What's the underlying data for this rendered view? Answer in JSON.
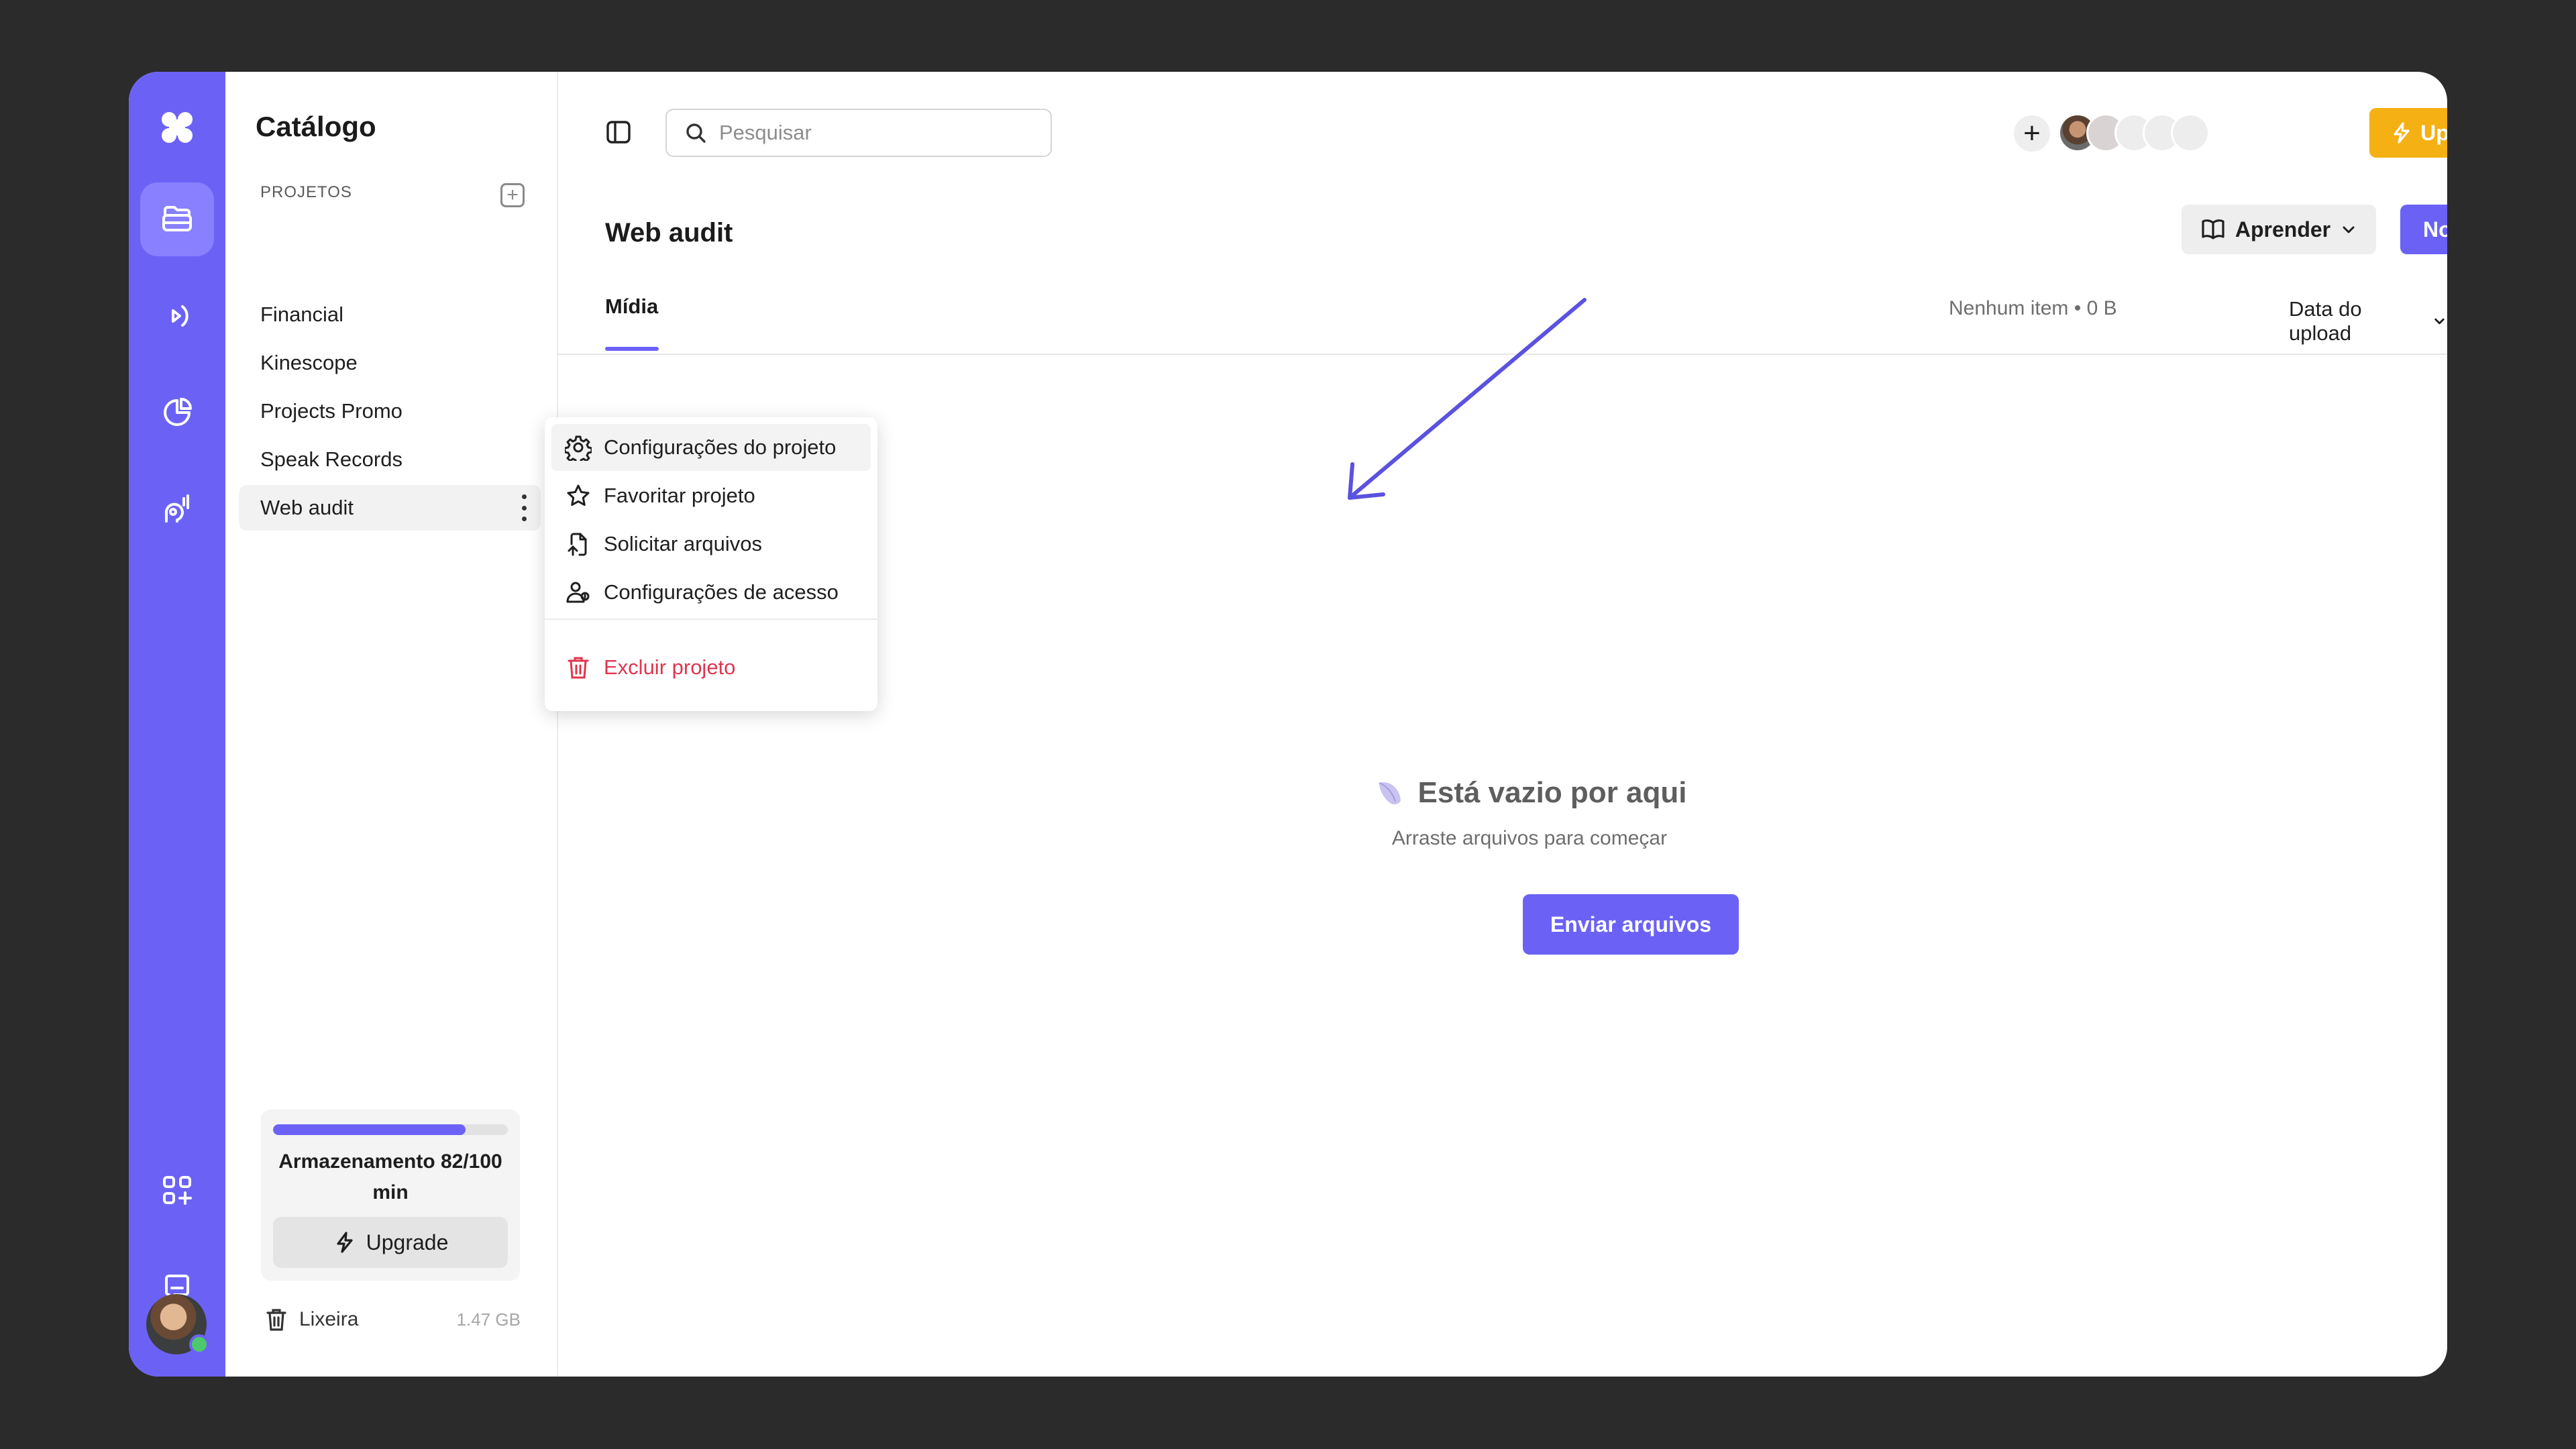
{
  "sidebar": {
    "title": "Catálogo",
    "section_label": "PROJETOS",
    "projects": [
      {
        "label": "Financial"
      },
      {
        "label": "Kinescope"
      },
      {
        "label": "Projects Promo"
      },
      {
        "label": "Speak Records"
      },
      {
        "label": "Web audit"
      }
    ],
    "selected_project": "Web audit",
    "storage": {
      "label": "Armazenamento 82/100 min",
      "used": 82,
      "total": 100,
      "unit": "min",
      "upgrade_label": "Upgrade"
    },
    "trash": {
      "label": "Lixeira",
      "size": "1.47 GB"
    }
  },
  "rail": {
    "icons": [
      "app-logo-icon",
      "folder-stack-icon",
      "broadcast-icon",
      "pie-chart-icon",
      "voice-icon",
      "apps-add-icon",
      "chat-icon"
    ],
    "active": "folder-stack-icon"
  },
  "header": {
    "search_placeholder": "Pesquisar",
    "upgrade_label": "Upgrade",
    "add_member_label": "+"
  },
  "main": {
    "page_title": "Web audit",
    "learn_label": "Aprender",
    "new_label": "Novo",
    "tab_label": "Mídia",
    "items_count": "Nenhum item • 0 B",
    "sort_label": "Data do upload",
    "empty": {
      "title": "Está vazio por aqui",
      "subtitle": "Arraste arquivos para começar",
      "action_label": "Enviar arquivos"
    }
  },
  "context_menu": {
    "items": [
      {
        "label": "Configurações do projeto",
        "icon": "gear-icon"
      },
      {
        "label": "Favoritar projeto",
        "icon": "star-icon"
      },
      {
        "label": "Solicitar arquivos",
        "icon": "request-files-icon"
      },
      {
        "label": "Configurações de acesso",
        "icon": "users-icon"
      }
    ],
    "danger_item": {
      "label": "Excluir projeto",
      "icon": "trash-icon"
    }
  },
  "colors": {
    "accent": "#6b62f5",
    "upgrade": "#f5b014",
    "danger": "#e0354f",
    "background": "#2b2b2b"
  }
}
